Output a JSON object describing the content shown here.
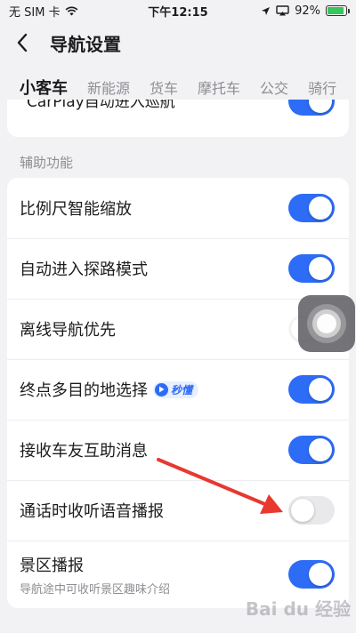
{
  "status_bar": {
    "carrier": "无 SIM 卡",
    "time": "下午12:15",
    "battery": "92%",
    "battery_level": 0.92
  },
  "nav": {
    "title": "导航设置"
  },
  "tabs": [
    {
      "label": "小客车",
      "active": true
    },
    {
      "label": "新能源",
      "active": false
    },
    {
      "label": "货车",
      "active": false
    },
    {
      "label": "摩托车",
      "active": false
    },
    {
      "label": "公交",
      "active": false
    },
    {
      "label": "骑行",
      "active": false
    }
  ],
  "top_card": {
    "partial_label": "CarPlay自动进入巡航",
    "toggle_on": true
  },
  "section": {
    "title": "辅助功能"
  },
  "settings": [
    {
      "label": "比例尺智能缩放",
      "on": true
    },
    {
      "label": "自动进入探路模式",
      "on": true
    },
    {
      "label": "离线导航优先",
      "on": false
    },
    {
      "label": "终点多目的地选择",
      "on": true,
      "badge": "秒懂"
    },
    {
      "label": "接收车友互助消息",
      "on": true
    },
    {
      "label": "通话时收听语音播报",
      "on": false
    },
    {
      "label": "景区播报",
      "on": true,
      "sub": "导航途中可收听景区趣味介绍"
    }
  ],
  "colors": {
    "accent": "#2d6cf6",
    "annotation_arrow": "#e8382f"
  },
  "watermark": "Bai du 经验"
}
